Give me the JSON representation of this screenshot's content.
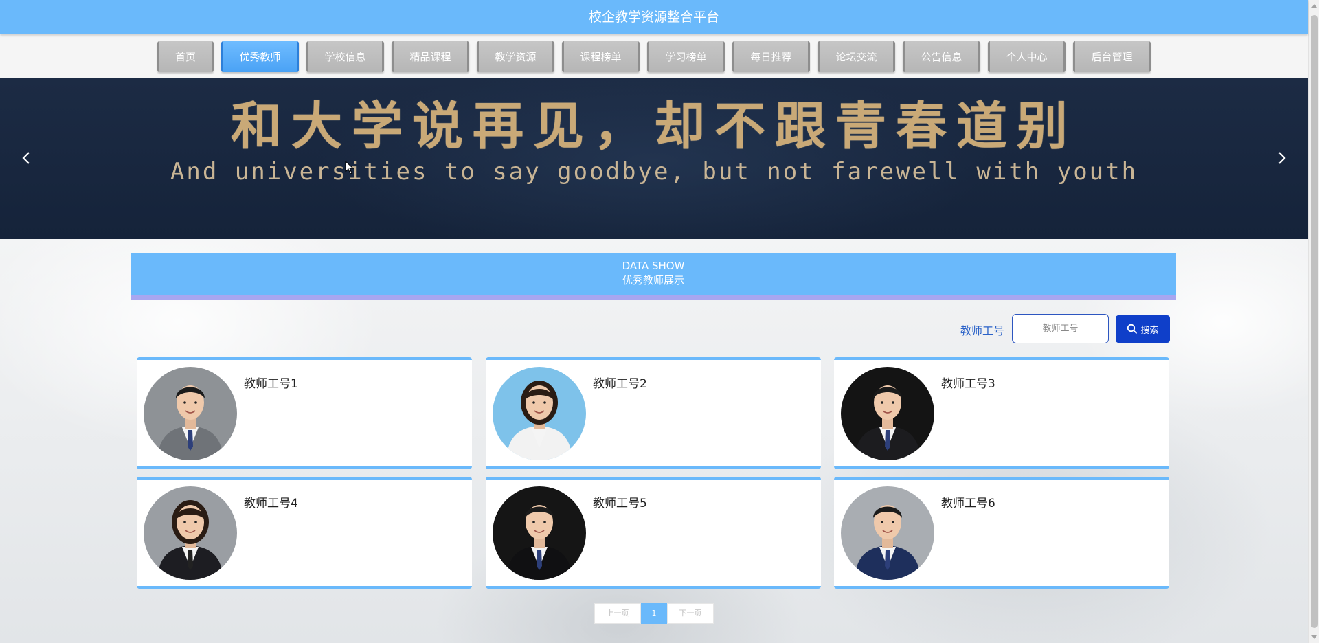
{
  "header": {
    "title": "校企教学资源整合平台"
  },
  "nav": {
    "items": [
      {
        "label": "首页"
      },
      {
        "label": "优秀教师",
        "active": true
      },
      {
        "label": "学校信息"
      },
      {
        "label": "精品课程"
      },
      {
        "label": "教学资源"
      },
      {
        "label": "课程榜单"
      },
      {
        "label": "学习榜单"
      },
      {
        "label": "每日推荐"
      },
      {
        "label": "论坛交流"
      },
      {
        "label": "公告信息"
      },
      {
        "label": "个人中心"
      },
      {
        "label": "后台管理"
      }
    ]
  },
  "banner": {
    "title": "和大学说再见，却不跟青春道别",
    "subtitle": "And universities to say goodbye, but not farewell with youth"
  },
  "section": {
    "title_en": "DATA SHOW",
    "title_cn": "优秀教师展示"
  },
  "search": {
    "label": "教师工号",
    "placeholder": "教师工号",
    "button_label": "搜索"
  },
  "teachers": [
    {
      "name": "教师工号1",
      "avatar": "male-gray-suit",
      "bg": "#8e9296",
      "suit": "#6f7378"
    },
    {
      "name": "教师工号2",
      "avatar": "female-blue-bg",
      "bg": "#7ec2ea",
      "suit": "#f2f2f2"
    },
    {
      "name": "教师工号3",
      "avatar": "male-dark-suit",
      "bg": "#141414",
      "suit": "#1c1c1f"
    },
    {
      "name": "教师工号4",
      "avatar": "female-dark-suit",
      "bg": "#9a9ea3",
      "suit": "#1d1d22"
    },
    {
      "name": "教师工号5",
      "avatar": "male-dark-bg",
      "bg": "#151515",
      "suit": "#101012"
    },
    {
      "name": "教师工号6",
      "avatar": "male-navy-suit",
      "bg": "#a9adb2",
      "suit": "#1e2f5c"
    }
  ],
  "pagination": {
    "prev": "上一页",
    "current": "1",
    "next": "下一页"
  },
  "colors": {
    "accent": "#6ab9fb",
    "nav_inactive": "#c0c0c0",
    "search_button": "#0f3fc9",
    "banner_text": "#c9a977"
  }
}
